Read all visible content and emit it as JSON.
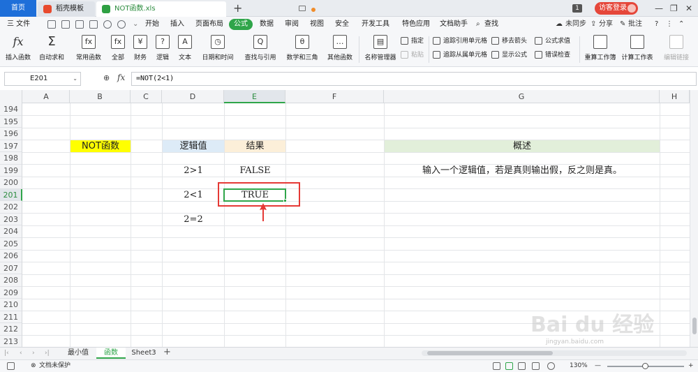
{
  "titlebar": {
    "home_tab": "首页",
    "template_tab": "稻壳模板",
    "file_tab": "NOT函数.xls",
    "new_tab_symbol": "+",
    "notify_count": "1",
    "guest_login": "访客登录",
    "minimize": "—",
    "restore": "❐",
    "close": "✕"
  },
  "menu": {
    "file": "三 文件",
    "tabs": [
      "开始",
      "插入",
      "页面布局",
      "公式",
      "数据",
      "审阅",
      "视图",
      "安全",
      "开发工具",
      "特色应用",
      "文档助手",
      "查找"
    ],
    "active_tab": "公式",
    "right": {
      "sync": "未同步",
      "share": "分享",
      "comment": "批注"
    }
  },
  "ribbon": {
    "big": [
      "插入函数",
      "自动求和",
      "常用函数",
      "全部",
      "财务",
      "逻辑",
      "文本",
      "日期和时间",
      "查找与引用",
      "数学和三角",
      "其他函数",
      "名称管理器"
    ],
    "big_icons": [
      "fx",
      "Σ",
      "fx",
      "fx",
      "¥",
      "?",
      "A",
      "◷",
      "Q",
      "θ",
      "…",
      "▤"
    ],
    "small": {
      "specify": "指定",
      "paste": "粘贴",
      "trace_precedents": "追踪引用单元格",
      "trace_dependents": "追踪从属单元格",
      "remove_arrows": "移去箭头",
      "show_formulas": "显示公式",
      "evaluate": "公式求值",
      "error_check": "错误检查"
    },
    "calc_workbook": "重算工作簿",
    "calc_sheet": "计算工作表",
    "edit_links": "编辑链接"
  },
  "formula_bar": {
    "name_box": "E201",
    "fx_label": "fx",
    "formula": "=NOT(2<1)"
  },
  "columns": [
    "A",
    "B",
    "C",
    "D",
    "E",
    "F",
    "G",
    "H"
  ],
  "selected_column": "E",
  "rows": [
    "194",
    "195",
    "196",
    "197",
    "198",
    "199",
    "200",
    "201",
    "202",
    "203",
    "204",
    "205",
    "206",
    "207",
    "208",
    "209",
    "210",
    "211",
    "212",
    "213"
  ],
  "selected_row": "201",
  "cells": {
    "B197": "NOT函数",
    "D197": "逻辑值",
    "E197": "结果",
    "G197": "概述",
    "D199": "2>1",
    "E199": "FALSE",
    "G199": "输入一个逻辑值，若是真则输出假，反之则是真。",
    "D201": "2<1",
    "E201": "TRUE",
    "D203": "2=2"
  },
  "colors": {
    "accent_green": "#2fa54a",
    "highlight_red": "#e53935",
    "yellow_fill": "#ffff00",
    "blue_fill": "#ddebf7",
    "orange_fill": "#fcefd9",
    "green_fill": "#e2efda"
  },
  "sheets": {
    "tabs": [
      "最小值",
      "函数",
      "Sheet3"
    ],
    "active": "函数",
    "add": "+"
  },
  "statusbar": {
    "protect": "文档未保护",
    "zoom": "130%",
    "zoom_minus": "—",
    "zoom_plus": "+"
  },
  "watermark": {
    "brand": "Bai du 经验",
    "url": "jingyan.baidu.com"
  }
}
